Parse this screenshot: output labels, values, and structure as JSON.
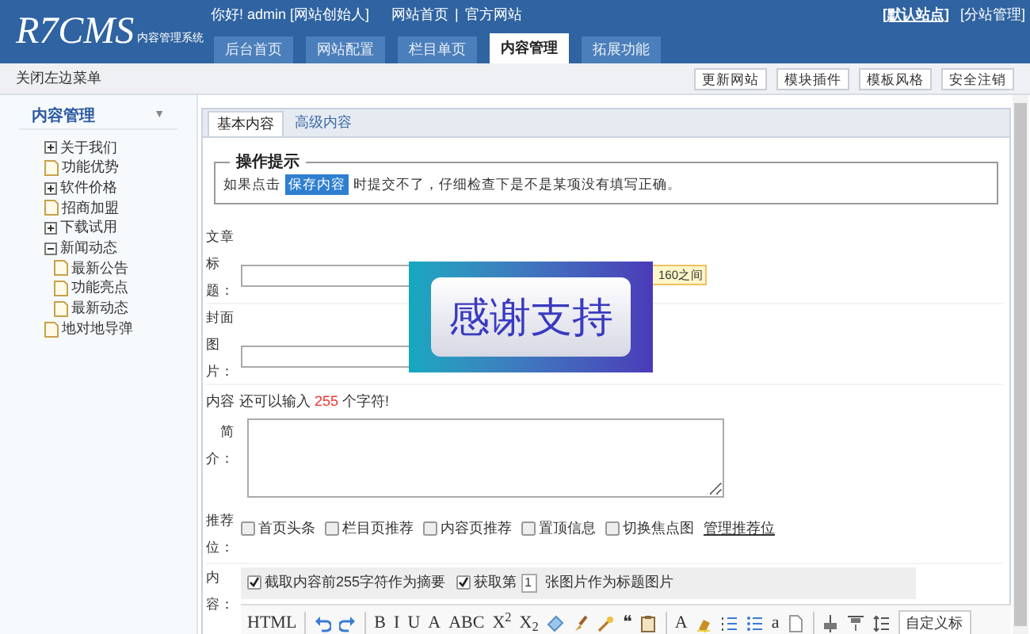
{
  "header": {
    "logo": "R7CMS",
    "subtitle": "内容管理系统",
    "greeting": "你好! admin [网站创始人]",
    "links": [
      {
        "label": "网站首页"
      },
      {
        "label": "|"
      },
      {
        "label": "官方网站"
      }
    ],
    "site_links": [
      {
        "label": "[默认站点]",
        "selected": true
      },
      {
        "label": "[分站管理]",
        "selected": false
      }
    ],
    "tabs": [
      {
        "label": "后台首页",
        "selected": false
      },
      {
        "label": "网站配置",
        "selected": false
      },
      {
        "label": "栏目单页",
        "selected": false
      },
      {
        "label": "内容管理",
        "selected": true
      },
      {
        "label": "拓展功能",
        "selected": false
      }
    ]
  },
  "toolbar": {
    "toggle": "关闭左边菜单",
    "buttons": [
      "更新网站",
      "模块插件",
      "模板风格",
      "安全注销"
    ]
  },
  "sidebar": {
    "title": "内容管理",
    "caret": "▼",
    "items": [
      {
        "label": "关于我们",
        "kind": "folder",
        "expanded": false
      },
      {
        "label": "功能优势",
        "kind": "page"
      },
      {
        "label": "软件价格",
        "kind": "folder",
        "expanded": false
      },
      {
        "label": "招商加盟",
        "kind": "page"
      },
      {
        "label": "下载试用",
        "kind": "folder",
        "expanded": false
      },
      {
        "label": "新闻动态",
        "kind": "folder",
        "expanded": true,
        "children": [
          {
            "label": "最新公告",
            "kind": "page"
          },
          {
            "label": "功能亮点",
            "kind": "page"
          },
          {
            "label": "最新动态",
            "kind": "page"
          }
        ]
      },
      {
        "label": "地对地导弹",
        "kind": "page"
      }
    ]
  },
  "content_tabs": [
    {
      "label": "基本内容",
      "selected": true
    },
    {
      "label": "高级内容",
      "selected": false
    }
  ],
  "tip": {
    "legend": "操作提示",
    "before": "如果点击",
    "button": "保存内容",
    "after": "时提交不了，仔细检查下是不是某项没有填写正确。"
  },
  "form": {
    "title": {
      "label": "文章标题：",
      "tooltip": "160之间"
    },
    "cover": {
      "label": "封面图片："
    },
    "summary": {
      "label_top": "内容",
      "hint": "还可以输入 **255** 个字符!",
      "label": "简介："
    },
    "recommend": {
      "label": "推荐位：",
      "options": [
        {
          "label": "首页头条",
          "checked": false
        },
        {
          "label": "栏目页推荐",
          "checked": false
        },
        {
          "label": "内容页推荐",
          "checked": false
        },
        {
          "label": "置顶信息",
          "checked": false
        },
        {
          "label": "切换焦点图",
          "checked": false
        }
      ],
      "manage_link": "管理推荐位"
    },
    "content": {
      "label": "内容：",
      "auto_summary": {
        "label": "截取内容前255字符作为摘要",
        "checked": true
      },
      "fetch_image": {
        "label": "获取第",
        "checked": true
      },
      "image_index": "1",
      "image_suffix": "张图片作为标题图片"
    },
    "editor_tools": [
      {
        "kind": "text",
        "label": "HTML"
      },
      {
        "kind": "sep"
      },
      {
        "kind": "undo"
      },
      {
        "kind": "redo"
      },
      {
        "kind": "sep"
      },
      {
        "kind": "text",
        "label": "B"
      },
      {
        "kind": "text",
        "label": "I"
      },
      {
        "kind": "text",
        "label": "U"
      },
      {
        "kind": "text",
        "label": "A"
      },
      {
        "kind": "text",
        "label": "ABC"
      },
      {
        "kind": "text",
        "label": "X$^{2}$"
      },
      {
        "kind": "text",
        "label": "X$_{2}$"
      },
      {
        "kind": "eraser"
      },
      {
        "kind": "brush"
      },
      {
        "kind": "wand"
      },
      {
        "kind": "text",
        "label": "❝"
      },
      {
        "kind": "paste"
      },
      {
        "kind": "sep"
      },
      {
        "kind": "text",
        "label": "A"
      },
      {
        "kind": "highlight"
      },
      {
        "kind": "ol"
      },
      {
        "kind": "ul"
      },
      {
        "kind": "text",
        "label": "a"
      },
      {
        "kind": "page"
      },
      {
        "kind": "sep"
      },
      {
        "kind": "align"
      },
      {
        "kind": "valign"
      },
      {
        "kind": "lineheight"
      }
    ],
    "heading_select": "自定义标"
  },
  "popup": {
    "text": "感谢支持"
  }
}
